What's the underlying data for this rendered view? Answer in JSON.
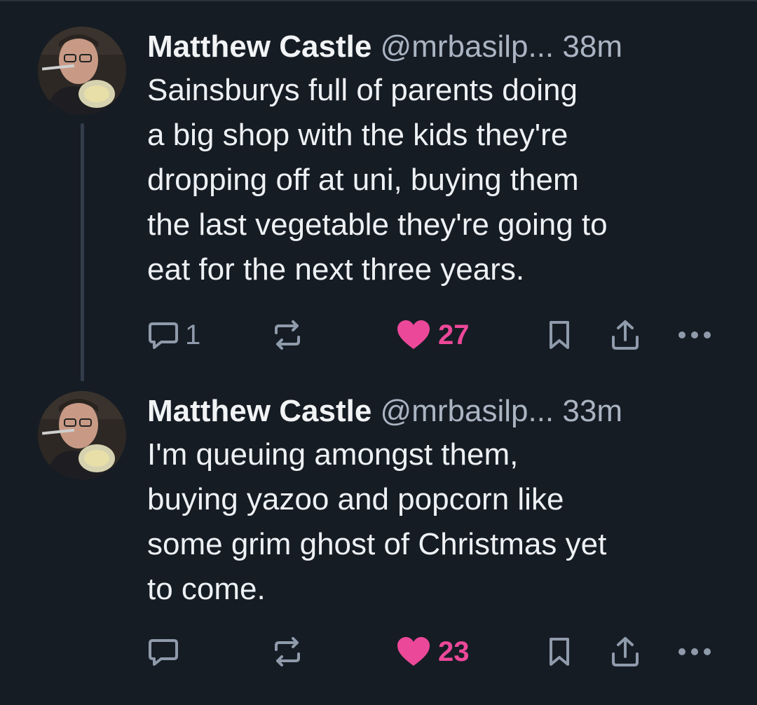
{
  "posts": [
    {
      "author": "Matthew Castle",
      "handle": "@mrbasilp...",
      "time": "38m",
      "lines": [
        "Sainsburys full of parents doing",
        "a big shop with the kids they're",
        "dropping off at uni, buying them",
        "the last vegetable they're going to",
        "eat for the next three years."
      ],
      "reply_count": "1",
      "like_count": "27"
    },
    {
      "author": "Matthew Castle",
      "handle": "@mrbasilp...",
      "time": "33m",
      "lines": [
        "I'm queuing amongst them,",
        "buying yazoo and popcorn like",
        "some grim ghost of Christmas yet",
        "to come."
      ],
      "reply_count": "",
      "like_count": "23"
    }
  ],
  "icons": {
    "reply": "reply-icon",
    "repost": "repost-icon",
    "like": "heart-icon",
    "bookmark": "bookmark-icon",
    "share": "share-icon",
    "more": "more-icon"
  },
  "colors": {
    "background": "#161c24",
    "text": "#eef1f4",
    "muted": "#8f9bab",
    "like": "#ec4899",
    "thread_line": "#323c4a"
  }
}
